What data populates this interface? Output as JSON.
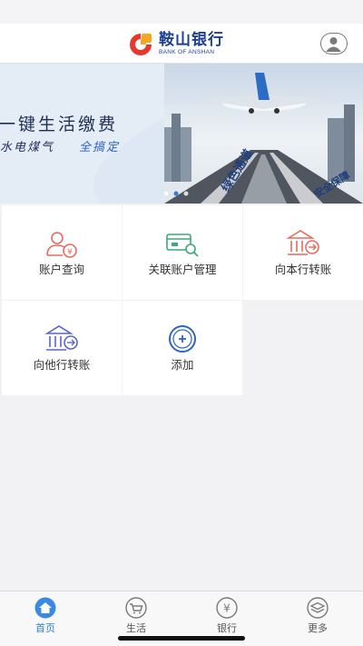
{
  "header": {
    "bank_name_cn": "鞍山银行",
    "bank_name_en": "BANK OF ANSHAN",
    "brand_color": "#1d3f8f",
    "logo_colors": [
      "#e8382b",
      "#f5a623"
    ],
    "profile_icon": "user-icon"
  },
  "banner": {
    "title": "一键生活缴费",
    "subtitle_left": "水电煤气",
    "subtitle_right": "全搞定",
    "runway_text_1": "绿色通道",
    "runway_text_2": "安全保障",
    "page_indicator_total": 3,
    "page_indicator_active": 1
  },
  "services": [
    {
      "label": "账户查询",
      "icon": "account-query-icon",
      "color": "#e56b5d"
    },
    {
      "label": "关联账户管理",
      "icon": "linked-account-icon",
      "color": "#3aaa7a"
    },
    {
      "label": "向本行转账",
      "icon": "bank-transfer-icon",
      "color": "#e56b5d"
    },
    {
      "label": "向他行转账",
      "icon": "other-bank-transfer-icon",
      "color": "#5a66c8"
    },
    {
      "label": "添加",
      "icon": "add-icon",
      "color": "#2f66c4"
    }
  ],
  "tabbar": {
    "active_color": "#2f7ed8",
    "items": [
      {
        "label": "首页",
        "icon": "home-icon"
      },
      {
        "label": "生活",
        "icon": "cart-icon"
      },
      {
        "label": "银行",
        "icon": "yuan-icon"
      },
      {
        "label": "更多",
        "icon": "layers-icon"
      }
    ]
  }
}
